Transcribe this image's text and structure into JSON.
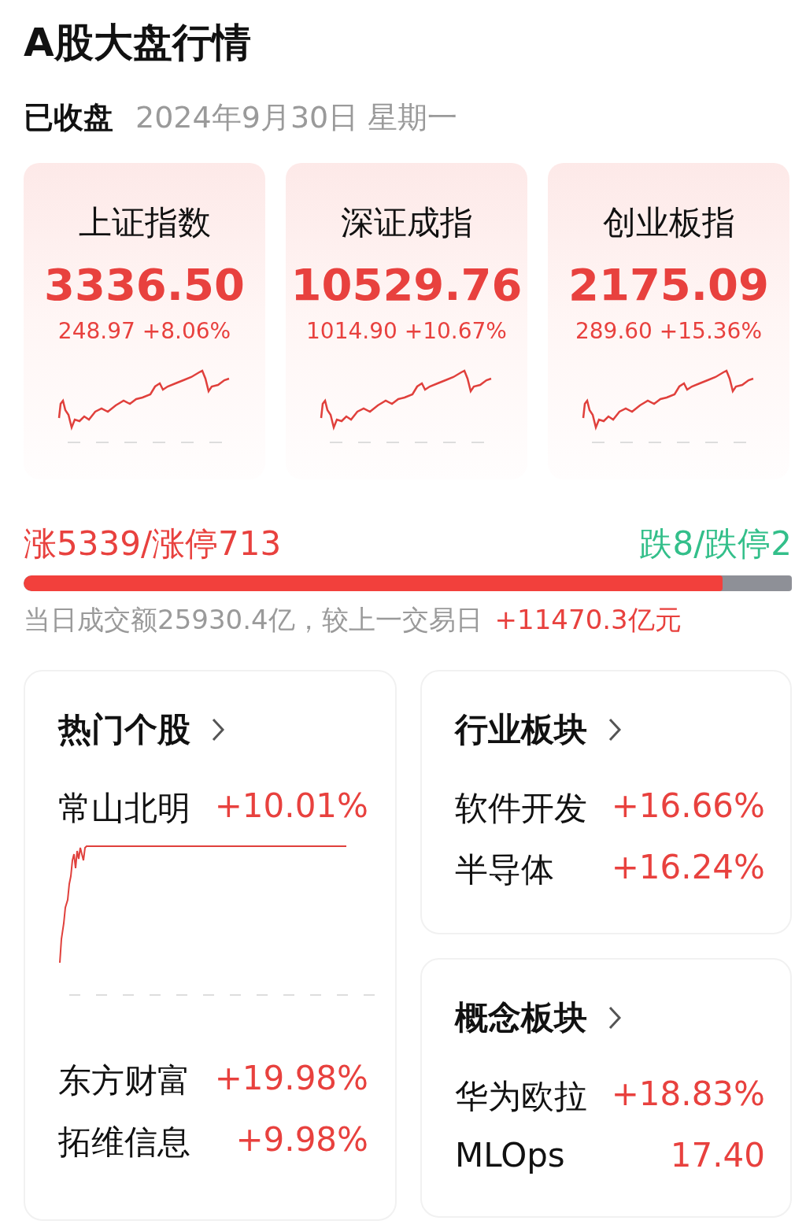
{
  "title": "A股大盘行情",
  "status": "已收盘",
  "date": "2024年9月30日 星期一",
  "indices": [
    {
      "name": "上证指数",
      "value": "3336.50",
      "change": "248.97 +8.06%"
    },
    {
      "name": "深证成指",
      "value": "10529.76",
      "change": "1014.90 +10.67%"
    },
    {
      "name": "创业板指",
      "value": "2175.09",
      "change": "289.60 +15.36%"
    }
  ],
  "breadth": {
    "up": "涨5339/涨停713",
    "down": "跌8/跌停2",
    "level": 0.91
  },
  "turnover": {
    "text": "当日成交额25930.4亿，较上一交易日",
    "delta": "+11470.3亿元"
  },
  "hot_stocks": {
    "title": "热门个股",
    "items": [
      {
        "name": "常山北明",
        "change": "+10.01%"
      },
      {
        "name": "东方财富",
        "change": "+19.98%"
      },
      {
        "name": "拓维信息",
        "change": "+9.98%"
      }
    ]
  },
  "industry": {
    "title": "行业板块",
    "items": [
      {
        "name": "软件开发",
        "change": "+16.66%"
      },
      {
        "name": "半导体",
        "change": "+16.24%"
      }
    ]
  },
  "concept": {
    "title": "概念板块",
    "items": [
      {
        "name": "华为欧拉",
        "change": "+18.83%"
      },
      {
        "name": "MLOps",
        "change": "17.40"
      }
    ]
  }
}
